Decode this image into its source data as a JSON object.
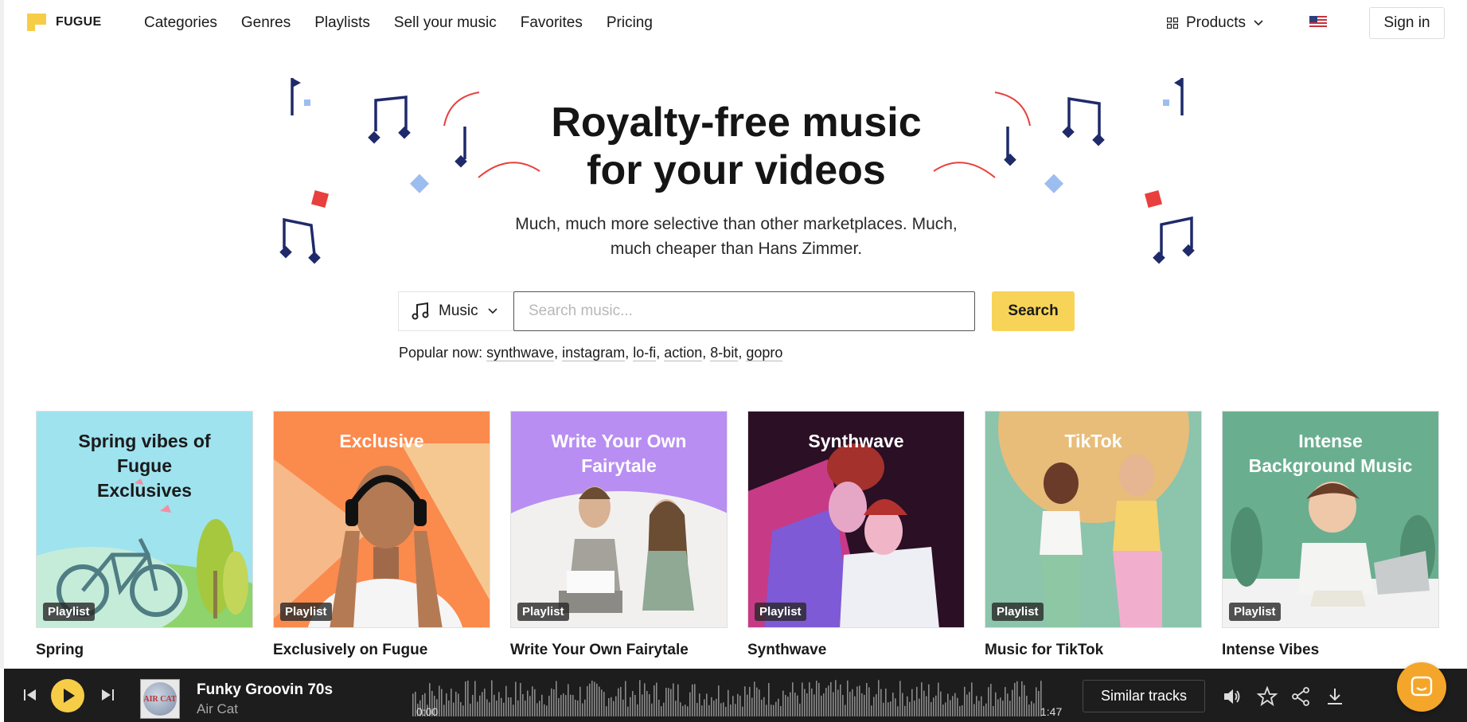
{
  "header": {
    "logo_text": "FUGUE",
    "nav": [
      "Categories",
      "Genres",
      "Playlists",
      "Sell your music",
      "Favorites",
      "Pricing"
    ],
    "products_label": "Products",
    "signin_label": "Sign in"
  },
  "hero": {
    "title_line1": "Royalty-free music",
    "title_line2": "for your videos",
    "subtitle_line1": "Much, much more selective than other marketplaces. Much,",
    "subtitle_line2": "much cheaper than Hans Zimmer."
  },
  "search": {
    "type_label": "Music",
    "placeholder": "Search music...",
    "button_label": "Search",
    "popular_label": "Popular now:",
    "popular_tags": [
      "synthwave",
      "instagram",
      "lo-fi",
      "action",
      "8-bit",
      "gopro"
    ]
  },
  "playlists": [
    {
      "image_title": "Spring vibes of Fugue Exclusives",
      "badge": "Playlist",
      "name": "Spring",
      "bg": "#9fe3ef"
    },
    {
      "image_title": "Exclusive",
      "badge": "Playlist",
      "name": "Exclusively on Fugue",
      "bg": "#fb8a4d"
    },
    {
      "image_title": "Write Your Own Fairytale",
      "badge": "Playlist",
      "name": "Write Your Own Fairytale",
      "bg": "#b88ef2"
    },
    {
      "image_title": "Synthwave",
      "badge": "Playlist",
      "name": "Synthwave",
      "bg": "#2a0f25"
    },
    {
      "image_title": "TikTok",
      "badge": "Playlist",
      "name": "Music for TikTok",
      "bg": "#8cc4ac"
    },
    {
      "image_title": "Intense Background Music",
      "badge": "Playlist",
      "name": "Intense Vibes",
      "bg": "#6aae90"
    }
  ],
  "player": {
    "title": "Funky Groovin 70s",
    "artist": "Air Cat",
    "time_current": "0:00",
    "time_total": "1:47",
    "similar_label": "Similar tracks",
    "thumb_text": "AIR CAT"
  },
  "colors": {
    "accent": "#f7cd47",
    "navy": "#1f2a6b",
    "red": "#e8403d",
    "lightblue": "#9cbdf0"
  }
}
